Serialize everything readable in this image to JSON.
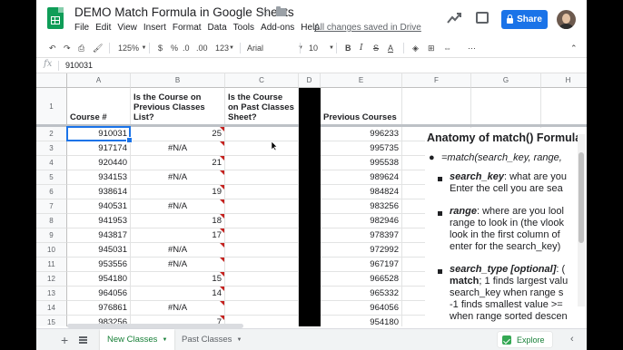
{
  "window": {
    "doc_title": "DEMO Match Formula in Google Sheets",
    "saved_status": "All changes saved in Drive",
    "share_label": "Share"
  },
  "menu": [
    "File",
    "Edit",
    "View",
    "Insert",
    "Format",
    "Data",
    "Tools",
    "Add-ons",
    "Help"
  ],
  "toolbar": {
    "zoom": "125%",
    "currency": "$",
    "percent": "%",
    "decimal_less": ".0",
    "decimal_more": ".00",
    "more_formats": "123",
    "font": "Arial",
    "font_size": "10",
    "bold": "B",
    "italic": "I",
    "strike": "S",
    "text_color": "A"
  },
  "formula_bar": {
    "fx": "fx",
    "value": "910031"
  },
  "columns": [
    "A",
    "B",
    "C",
    "D",
    "E",
    "F",
    "G",
    "H"
  ],
  "header_row": {
    "row_num": "1",
    "A": "Course #",
    "B": "Is the Course on Previous Classes List?",
    "C": "Is the Course on Past Classes Sheet?",
    "E": "Previous Courses"
  },
  "rows": [
    {
      "n": "2",
      "A": "910031",
      "B": "25",
      "E": "996233"
    },
    {
      "n": "3",
      "A": "917174",
      "B": "#N/A",
      "E": "995735"
    },
    {
      "n": "4",
      "A": "920440",
      "B": "21",
      "E": "995538"
    },
    {
      "n": "5",
      "A": "934153",
      "B": "#N/A",
      "E": "989624"
    },
    {
      "n": "6",
      "A": "938614",
      "B": "19",
      "E": "984824"
    },
    {
      "n": "7",
      "A": "940531",
      "B": "#N/A",
      "E": "983256"
    },
    {
      "n": "8",
      "A": "941953",
      "B": "18",
      "E": "982946"
    },
    {
      "n": "9",
      "A": "943817",
      "B": "17",
      "E": "978397"
    },
    {
      "n": "10",
      "A": "945031",
      "B": "#N/A",
      "E": "972992"
    },
    {
      "n": "11",
      "A": "953556",
      "B": "#N/A",
      "E": "967197"
    },
    {
      "n": "12",
      "A": "954180",
      "B": "15",
      "E": "966528"
    },
    {
      "n": "13",
      "A": "964056",
      "B": "14",
      "E": "965332"
    },
    {
      "n": "14",
      "A": "976861",
      "B": "#N/A",
      "E": "964056"
    },
    {
      "n": "15",
      "A": "983256",
      "B": "7",
      "E": "954180"
    }
  ],
  "slide": {
    "heading": "Anatomy of match() Formula",
    "syntax": "=match(search_key, range,",
    "search_key_term": "search_key",
    "search_key_line1": ": what are you",
    "search_key_line2": "Enter the cell you are sea",
    "range_term": "range",
    "range_line1": ": where are you lool",
    "range_line2": "range to look in (the vlook",
    "range_line3": "look in the first column of",
    "range_line4": "enter for the search_key)",
    "type_term": "search_type [optional]",
    "type_line1_tail": ": (",
    "type_line2_bold": "match",
    "type_line2": "; 1 finds largest valu",
    "type_line3": "search_key when range s",
    "type_line4": "-1 finds smallest value >=",
    "type_line5": "when range sorted descen"
  },
  "tabs": {
    "active": "New Classes",
    "other": "Past Classes",
    "explore": "Explore"
  },
  "colors": {
    "accent": "#1a73e8",
    "sheets_green": "#0f9d58",
    "error_marker": "#c5221f"
  }
}
